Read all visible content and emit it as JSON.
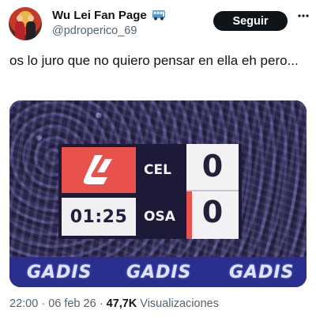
{
  "author": {
    "display_name": "Wu Lei Fan Page",
    "handle": "@pdroperico_69",
    "name_emoji_icon": "bus-icon"
  },
  "follow_button": {
    "label": "Seguir"
  },
  "menu_icon": "more-options-icon",
  "tweet": {
    "text": "os lo juro que no quiero pensar en ella eh pero..."
  },
  "media": {
    "scoreboard": {
      "logo_icon": "laliga-logo-icon",
      "clock": "01:25",
      "home_team": "CEL",
      "away_team": "OSA",
      "home_score": "0",
      "away_score": "0"
    },
    "ad_banner": [
      "GADIS",
      "GADIS",
      "GADIS"
    ],
    "colors": {
      "logo_red": "#e8514c",
      "board_dark": "#1c1a36",
      "banner_blue": "#2a2f8e"
    }
  },
  "meta": {
    "time": "22:00",
    "sep1": " · ",
    "date": "06 feb 26",
    "sep2": " · ",
    "views_count": "47,7K",
    "views_label": " Visualizaciones"
  }
}
